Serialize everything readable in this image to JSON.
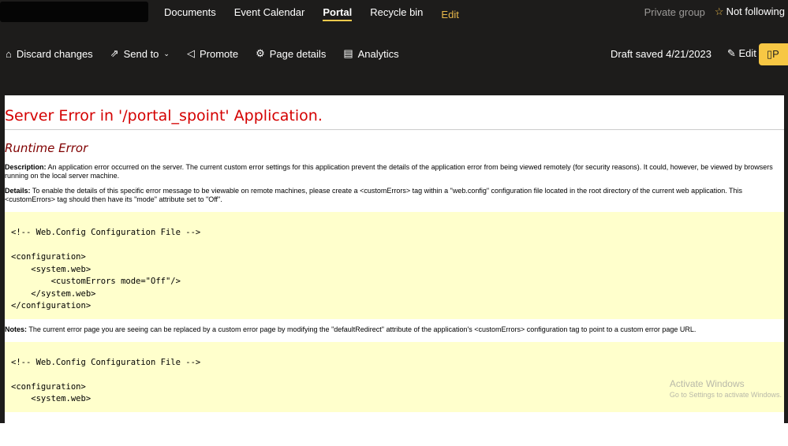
{
  "nav": {
    "items": [
      "Documents",
      "Event Calendar",
      "Portal",
      "Recycle bin"
    ],
    "edit": "Edit",
    "private_group": "Private group",
    "follow": "Not following"
  },
  "toolbar": {
    "discard": "Discard changes",
    "send_to": "Send to",
    "promote": "Promote",
    "page_details": "Page details",
    "analytics": "Analytics",
    "draft_saved": "Draft saved 4/21/2023",
    "edit": "Edit",
    "publish": "P"
  },
  "error": {
    "title": "Server Error in '/portal_spoint' Application.",
    "subtitle": "Runtime Error",
    "desc_label": "Description:",
    "desc": " An application error occurred on the server. The current custom error settings for this application prevent the details of the application error from being viewed remotely (for security reasons). It could, however, be viewed by browsers running on the local server machine.",
    "details_label": "Details:",
    "details": " To enable the details of this specific error message to be viewable on remote machines, please create a <customErrors> tag within a \"web.config\" configuration file located in the root directory of the current web application. This <customErrors> tag should then have its \"mode\" attribute set to \"Off\".",
    "code1": "<!-- Web.Config Configuration File -->\n\n<configuration>\n    <system.web>\n        <customErrors mode=\"Off\"/>\n    </system.web>\n</configuration>",
    "notes_label": "Notes:",
    "notes": " The current error page you are seeing can be replaced by a custom error page by modifying the \"defaultRedirect\" attribute of the application's <customErrors> configuration tag to point to a custom error page URL.",
    "code2": "<!-- Web.Config Configuration File -->\n\n<configuration>\n    <system.web>"
  },
  "watermark": {
    "title": "Activate Windows",
    "sub": "Go to Settings to activate Windows."
  }
}
